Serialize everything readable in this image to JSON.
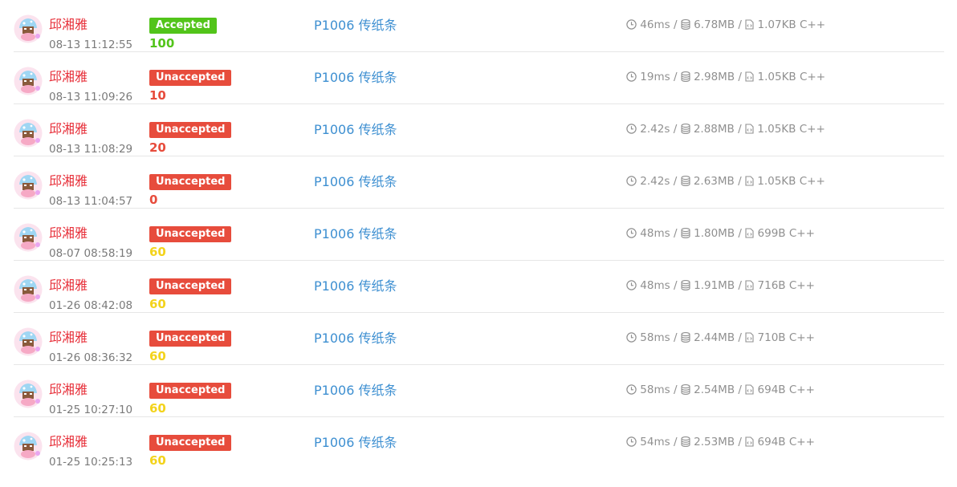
{
  "colors": {
    "user": "#e7303a",
    "accepted_bg": "#52c41a",
    "unaccepted_bg": "#e74c3c",
    "score_good": "#52c41a",
    "score_bad": "#e74c3c",
    "score_mid": "#f3d31c",
    "link": "#3d8fd1"
  },
  "icons": {
    "time": "clock-icon",
    "memory": "database-icon",
    "code": "file-code-icon"
  },
  "records": [
    {
      "user": "邱湘雅",
      "time": "08-13 11:12:55",
      "status": "Accepted",
      "score": "100",
      "score_level": "good",
      "problem": "P1006 传纸条",
      "runtime": "46ms",
      "memory": "6.78MB",
      "code_size": "1.07KB",
      "lang": "C++"
    },
    {
      "user": "邱湘雅",
      "time": "08-13 11:09:26",
      "status": "Unaccepted",
      "score": "10",
      "score_level": "bad",
      "problem": "P1006 传纸条",
      "runtime": "19ms",
      "memory": "2.98MB",
      "code_size": "1.05KB",
      "lang": "C++"
    },
    {
      "user": "邱湘雅",
      "time": "08-13 11:08:29",
      "status": "Unaccepted",
      "score": "20",
      "score_level": "bad",
      "problem": "P1006 传纸条",
      "runtime": "2.42s",
      "memory": "2.88MB",
      "code_size": "1.05KB",
      "lang": "C++"
    },
    {
      "user": "邱湘雅",
      "time": "08-13 11:04:57",
      "status": "Unaccepted",
      "score": "0",
      "score_level": "bad",
      "problem": "P1006 传纸条",
      "runtime": "2.42s",
      "memory": "2.63MB",
      "code_size": "1.05KB",
      "lang": "C++"
    },
    {
      "user": "邱湘雅",
      "time": "08-07 08:58:19",
      "status": "Unaccepted",
      "score": "60",
      "score_level": "mid",
      "problem": "P1006 传纸条",
      "runtime": "48ms",
      "memory": "1.80MB",
      "code_size": "699B",
      "lang": "C++"
    },
    {
      "user": "邱湘雅",
      "time": "01-26 08:42:08",
      "status": "Unaccepted",
      "score": "60",
      "score_level": "mid",
      "problem": "P1006 传纸条",
      "runtime": "48ms",
      "memory": "1.91MB",
      "code_size": "716B",
      "lang": "C++"
    },
    {
      "user": "邱湘雅",
      "time": "01-26 08:36:32",
      "status": "Unaccepted",
      "score": "60",
      "score_level": "mid",
      "problem": "P1006 传纸条",
      "runtime": "58ms",
      "memory": "2.44MB",
      "code_size": "710B",
      "lang": "C++"
    },
    {
      "user": "邱湘雅",
      "time": "01-25 10:27:10",
      "status": "Unaccepted",
      "score": "60",
      "score_level": "mid",
      "problem": "P1006 传纸条",
      "runtime": "58ms",
      "memory": "2.54MB",
      "code_size": "694B",
      "lang": "C++"
    },
    {
      "user": "邱湘雅",
      "time": "01-25 10:25:13",
      "status": "Unaccepted",
      "score": "60",
      "score_level": "mid",
      "problem": "P1006 传纸条",
      "runtime": "54ms",
      "memory": "2.53MB",
      "code_size": "694B",
      "lang": "C++"
    }
  ]
}
